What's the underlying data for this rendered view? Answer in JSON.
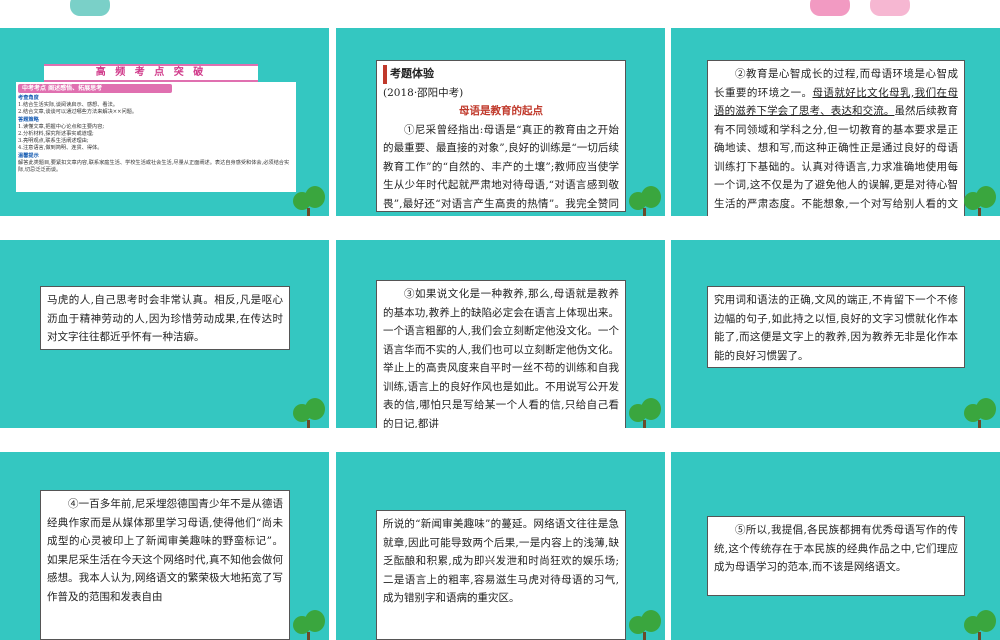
{
  "header": {
    "section_title": "高 频 考 点 突 破"
  },
  "topic_card": {
    "banner": "中考考点 阐述感悟、拓展思考",
    "label_angle": "考查角度",
    "angles": [
      "1.结合生活实际,谈阅读启示、感想、看法。",
      "2.结合文章,谈谈可以通过哪些方法来解决××问题。"
    ],
    "label_strategy": "答题策略",
    "strategies": [
      "1.读懂文章,把握中心论点和主要内容;",
      "2.分析材料,探究所述事实或道理;",
      "3.亮明观点,联系生活阐述理由;",
      "4.注意语言,做到简明、连贯、得体。"
    ],
    "label_tip": "温馨提示",
    "tip": "解答此类题目,要紧扣文章内容,联系家庭生活、学校生活或社会生活,尽量从正面阐述。表达自身感受和体会,必须结合实际,切忌泛泛而谈。"
  },
  "exam": {
    "label": "考题体验",
    "source": "(2018·邵阳中考)",
    "title": "母语是教育的起点",
    "p1": "①尼采曾经指出:母语是“真正的教育由之开始的最重要、最直接的对象”,良好的训练是“一切后续教育工作”的“自然的、丰产的土壤”;教师应当使学生从少年时代起就严肃地对待母语,“对语言感到敬畏”,最好还“对语言产生高贵的热情”。我完全赞同他的见解。"
  },
  "p2": {
    "a": "②教育是心智成长的过程,而母语环境是心智成长重要的环境之一。",
    "b": "母语就好比文化母乳,我们在母语的滋养下学会了思考、表达和交流。",
    "c": "虽然后续教育有不同领域和学科之分,但一切教育的基本要求是正确地读、想和写,而这种正确性正是通过良好的母语训练打下基础的。认真对待语言,力求准确地使用每一个词,这不仅是为了避免他人的误解,更是对待心智生活的严肃态度。不能想象,一个对写给别人看的文字极其",
    "cont": "马虎的人,自己思考时会非常认真。相反,凡是呕心沥血于精神劳动的人,因为珍惜劳动成果,在传达时对文字往往都近乎怀有一种洁癖。"
  },
  "p3": {
    "text": "③如果说文化是一种教养,那么,母语就是教养的基本功,教养上的缺陷必定会在语言上体现出来。一个语言粗鄙的人,我们会立刻断定他没文化。一个语言华而不实的人,我们也可以立刻断定他伪文化。举止上的高贵风度来自平时一丝不苟的训练和自我训练,语言上的良好作风也是如此。不用说写公开发表的信,哪怕只是写给某一个人看的信,只给自己看的日记,都讲",
    "cont": "究用词和语法的正确,文风的端正,不肯留下一个不修边幅的句子,如此持之以恒,良好的文字习惯就化作本能了,而这便是文字上的教养,因为教养无非是化作本能的良好习惯罢了。"
  },
  "p4": {
    "text": "④一百多年前,尼采埋怨德国青少年不是从德语经典作家而是从媒体那里学习母语,使得他们“尚未成型的心灵被印上了新闻审美趣味的野蛮标记”。如果尼采生活在今天这个网络时代,真不知他会做何感想。我本人认为,网络语文的繁荣极大地拓宽了写作普及的范围和发表自由",
    "cont": "所说的“新闻审美趣味”的蔓延。网络语文往往是急就章,因此可能导致两个后果,一是内容上的浅薄,缺乏酝酿和积累,成为即兴发泄和时尚狂欢的娱乐场;二是语言上的粗率,容易滋生马虎对待母语的习气,成为错别字和语病的重灾区。"
  },
  "p5": {
    "text": "⑤所以,我提倡,各民族都拥有优秀母语写作的传统,这个传统存在于本民族的经典作品之中,它们理应成为母语学习的范本,而不该是网络语文。"
  }
}
